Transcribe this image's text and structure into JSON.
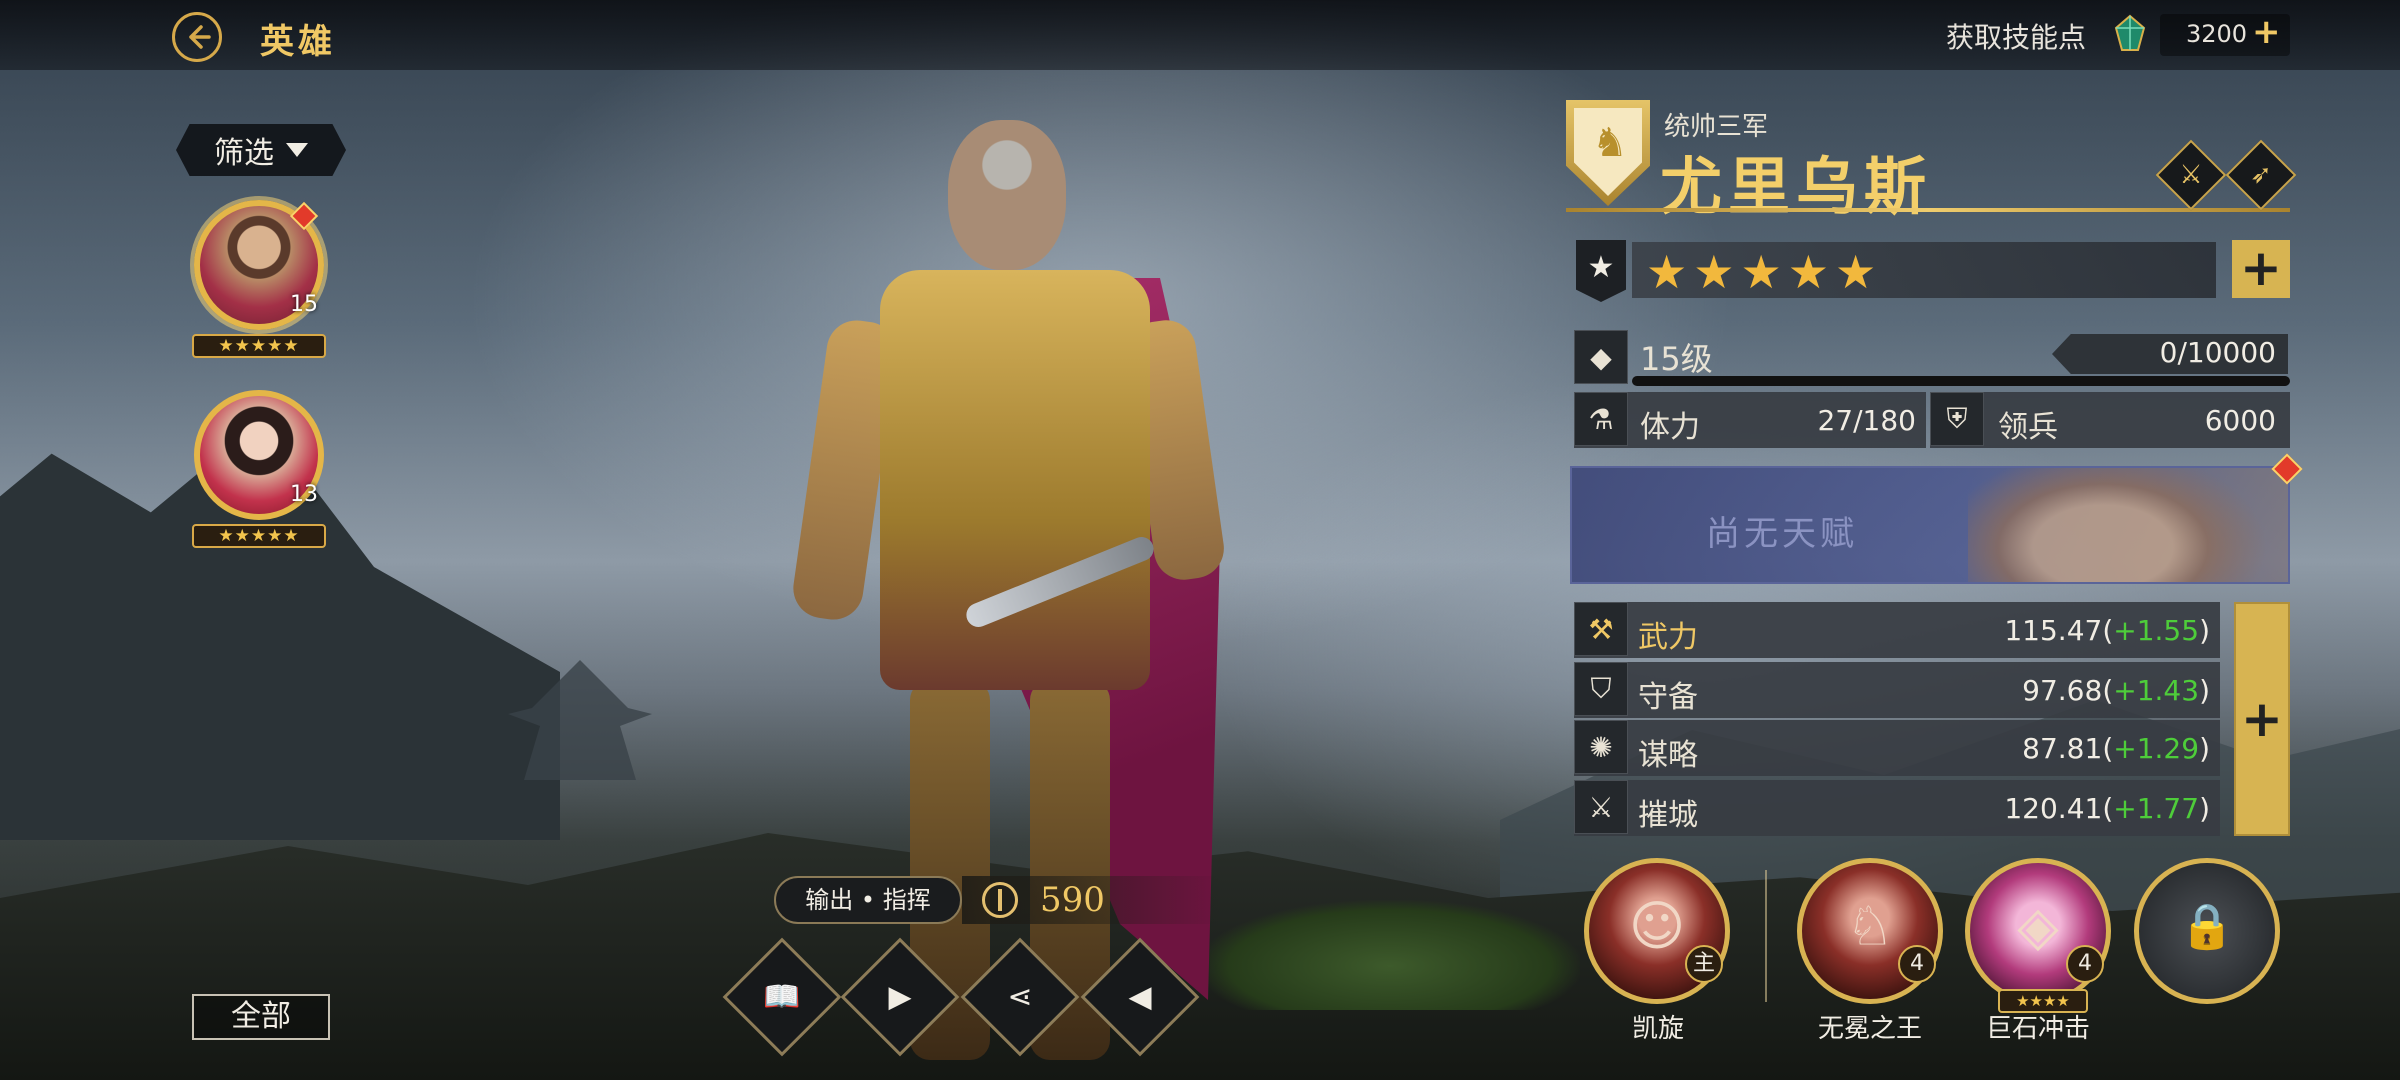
{
  "header": {
    "title": "英雄",
    "skill_points_label": "获取技能点",
    "skill_points_value": "3200",
    "add_symbol": "+"
  },
  "filter": {
    "label": "筛选"
  },
  "hero_list": [
    {
      "level": "15",
      "stars": "★★★★★",
      "selected": true,
      "has_alert": true
    },
    {
      "level": "13",
      "stars": "★★★★★",
      "selected": false,
      "has_alert": false
    }
  ],
  "all_button": "全部",
  "hero": {
    "subtitle": "统帅三军",
    "name": "尤里乌斯",
    "stars": "★★★★★",
    "level_text": "15级",
    "exp": "0/10000",
    "exp_progress": 0,
    "stamina_label": "体力",
    "stamina_value": "27/180",
    "troops_label": "领兵",
    "troops_value": "6000",
    "talent_text": "尚无天赋",
    "role": "输出 • 指挥",
    "power": "590"
  },
  "attributes": [
    {
      "label": "武力",
      "base": "115.47(",
      "bonus": "+1.55",
      "close": ")",
      "label_color": "#f0c865"
    },
    {
      "label": "守备",
      "base": "97.68(",
      "bonus": "+1.43",
      "close": ")",
      "label_color": "#e8e2d4"
    },
    {
      "label": "谋略",
      "base": "87.81(",
      "bonus": "+1.29",
      "close": ")",
      "label_color": "#e8e2d4"
    },
    {
      "label": "摧城",
      "base": "120.41(",
      "bonus": "+1.77",
      "close": ")",
      "label_color": "#e8e2d4"
    }
  ],
  "skills": [
    {
      "name": "凯旋",
      "badge": "主"
    },
    {
      "name": "无冕之王",
      "badge": "4"
    },
    {
      "name": "巨石冲击",
      "badge": "4",
      "stars": "★★★★"
    }
  ],
  "colors": {
    "gold": "#f0c865",
    "bonus_green": "#4ecd3a",
    "alert_red": "#e23a2a"
  },
  "icons": {
    "back": "back-arrow-icon",
    "gem": "gem-icon",
    "star_cap": "star-icon",
    "diamond": "diamond-icon",
    "flask": "flask-icon",
    "helmet": "helmet-icon",
    "attack": "axe-icon",
    "defense": "shield-icon",
    "strategy": "brain-icon",
    "siege": "siege-icon",
    "lock": "lock-icon"
  }
}
